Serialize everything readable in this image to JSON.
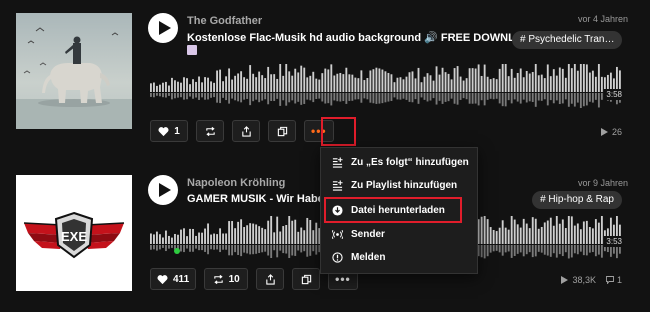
{
  "tracks": [
    {
      "artist": "The Godfather",
      "title": "Kostenlose Flac-Musik hd audio background 🔊 FREE DOWNLOAD",
      "age": "vor 4 Jahren",
      "tag": "# Psychedelic Tran…",
      "duration": "3:58",
      "likes": "1",
      "reposts": "",
      "plays": "26",
      "comments": "",
      "progress": 0
    },
    {
      "artist": "Napoleon Kröhling",
      "title": "GAMER MUSIK - Wir Haben E",
      "age": "vor 9 Jahren",
      "tag": "# Hip-hop & Rap",
      "duration": "3:53",
      "likes": "411",
      "reposts": "10",
      "plays": "38,3K",
      "comments": "1",
      "progress": 0
    }
  ],
  "menu": {
    "items": [
      {
        "label": "Zu „Es folgt“ hinzufügen",
        "icon": "add-to-next-up-icon"
      },
      {
        "label": "Zu Playlist hinzufügen",
        "icon": "add-to-playlist-icon"
      },
      {
        "label": "Datei herunterladen",
        "icon": "download-icon"
      },
      {
        "label": "Sender",
        "icon": "station-icon"
      },
      {
        "label": "Melden",
        "icon": "report-icon"
      }
    ]
  },
  "colors": {
    "accent": "#ff5500",
    "highlight": "#e11d2b",
    "background": "#121212",
    "waveform": "#cfcfcf",
    "progress_marker": "#2ecc40"
  }
}
